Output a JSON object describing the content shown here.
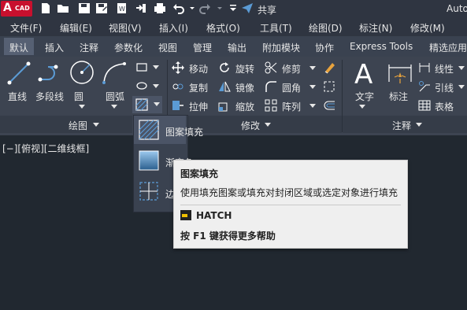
{
  "app": {
    "logo_letter": "A",
    "logo_sub": "CAD",
    "title": "Autoc"
  },
  "quick_access": {
    "share_label": "共享"
  },
  "menu": [
    {
      "label": "文件(F)"
    },
    {
      "label": "编辑(E)"
    },
    {
      "label": "视图(V)"
    },
    {
      "label": "插入(I)"
    },
    {
      "label": "格式(O)"
    },
    {
      "label": "工具(T)"
    },
    {
      "label": "绘图(D)"
    },
    {
      "label": "标注(N)"
    },
    {
      "label": "修改(M)"
    }
  ],
  "tabs": [
    {
      "label": "默认",
      "active": true
    },
    {
      "label": "插入"
    },
    {
      "label": "注释"
    },
    {
      "label": "参数化"
    },
    {
      "label": "视图"
    },
    {
      "label": "管理"
    },
    {
      "label": "输出"
    },
    {
      "label": "附加模块"
    },
    {
      "label": "协作"
    },
    {
      "label": "Express Tools"
    },
    {
      "label": "精选应用"
    }
  ],
  "ribbon": {
    "draw": {
      "title": "绘图",
      "line": "直线",
      "polyline": "多段线",
      "circle": "圆",
      "arc": "圆弧"
    },
    "modify": {
      "title": "修改",
      "move": "移动",
      "rotate": "旋转",
      "trim": "修剪",
      "copy": "复制",
      "mirror": "镜像",
      "fillet": "圆角",
      "stretch": "拉伸",
      "scale": "缩放",
      "array": "阵列"
    },
    "annotation": {
      "title": "注释",
      "text": "文字",
      "dimension": "标注",
      "linear": "线性",
      "leader": "引线",
      "table": "表格"
    }
  },
  "viewport": {
    "label": "[−][俯视][二维线框]"
  },
  "dropdown": {
    "items": [
      {
        "label": "图案填充"
      },
      {
        "label": "渐变色"
      },
      {
        "label": "边界"
      }
    ]
  },
  "tooltip": {
    "title": "图案填充",
    "description": "使用填充图案或填充对封闭区域或选定对象进行填充",
    "command": "HATCH",
    "help": "按 F1 键获得更多帮助"
  },
  "colors": {
    "logo": "#c8102e",
    "background": "#212830",
    "ribbon": "#3d4451",
    "tooltip_bg": "#efefef",
    "accent_blue": "#5b9bd5"
  }
}
